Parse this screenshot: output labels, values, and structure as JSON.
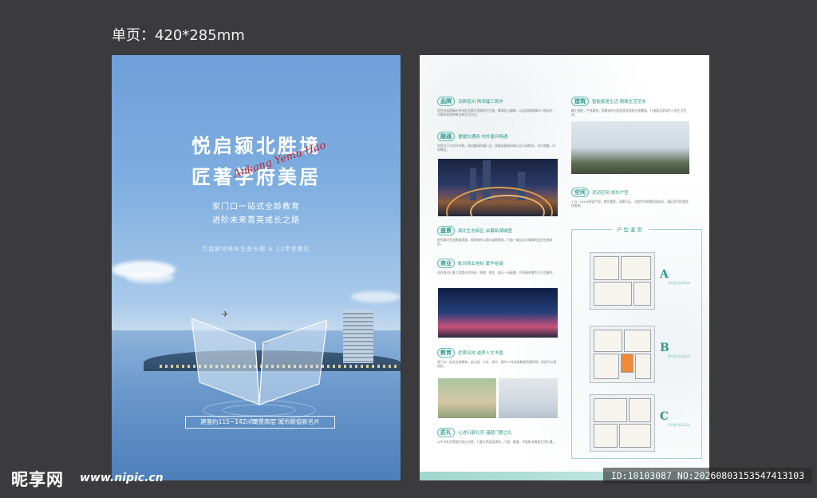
{
  "size_label": "单页：420*285mm",
  "front": {
    "title_line1": "悦启颍北胜境",
    "title_line2": "匠著学府美居",
    "signature": "Ankang Yemu Hao",
    "subtitle_line1": "家门口一站式全龄教育",
    "subtitle_line2": "进阶未来菁英成长之路",
    "tagline": "万亩颍河林水生态长廊 & 12年优教区",
    "banner": "建面约115~142㎡瞰景高层   城市颜值新名片"
  },
  "back": {
    "sections_left": [
      {
        "tag": "品牌",
        "title": "深耕亳州 再添璀工筑作",
        "text": "项目由深耕亳州多年的品牌开发商倾力打造，秉承匠心精神，以品质铸就城市人居标杆，为城市家庭带来全新生活方式。"
      },
      {
        "tag": "融通",
        "title": "便捷交通网 内外循环畅通",
        "text": "项目位于大外环内侧，周边路网四通八达，快速连接城市核心区与高铁站，出行便捷，内外畅达。"
      },
      {
        "tag": "盛景",
        "title": "湖北生态新区 启幕新湖城图",
        "text": "依托颍河生态廊道资源，规划城市公园与湿地景观，打造一城山水半城绿的宜居生态新区。"
      },
      {
        "tag": "商业",
        "title": "毗邻商业地标 繁华拾掇",
        "text": "项目周边汇聚大型商业综合体，购物、餐饮、娱乐一站配套，尽享城市繁华与生活便利。"
      },
      {
        "tag": "教育",
        "title": "优质名校 滋养人文书香",
        "text": "家门口一站式全龄教育，幼儿园、小学、初中、高中12年优质教育资源环伺，伴孩子从容成长。"
      },
      {
        "tag": "匠礼",
        "title": "七进归家礼序 谨献门第之礼",
        "text": "以中式礼序营造归家仪式感，七重礼序层层递进，门庭、廊道、中庭彰显尊贵生活礼遇。"
      }
    ],
    "sections_right": [
      {
        "tag": "建筑",
        "title": "智能家居生活 精致生活范本",
        "text": "精工细作，严选建材，智能安防与智慧家居系统全面覆盖，打造高品质现代人居生活范本。"
      },
      {
        "tag": "空间",
        "title": "灵动空间 成长户型",
        "text": "115~142㎡舒适户型，南北通透，动静分区，可变空间伴随家庭成长，满足多代同堂居住需求。"
      }
    ],
    "plan_title": "户型鉴赏",
    "plans": [
      {
        "letter": "A",
        "label": "A户型 约142㎡"
      },
      {
        "letter": "B",
        "label": "B户型 约128㎡"
      },
      {
        "letter": "C",
        "label": "C户型 约115㎡"
      }
    ]
  },
  "watermark": {
    "logo_text": "昵享网",
    "url": "www.nipic.cn",
    "id_text": "ID:10103087 NO:20260803153547413103"
  }
}
